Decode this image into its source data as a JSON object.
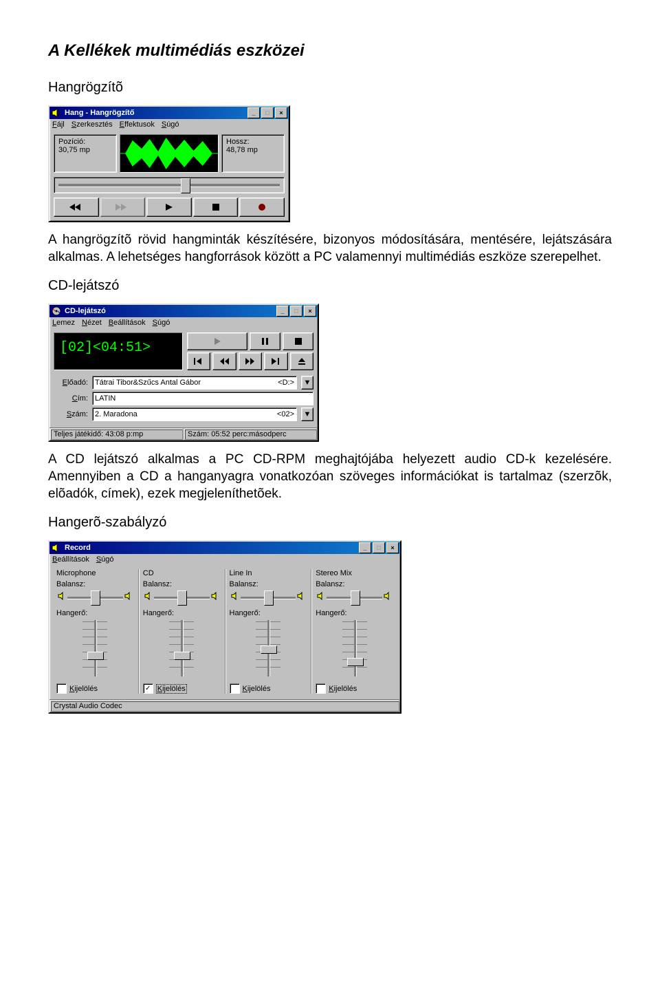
{
  "page": {
    "title": "A Kellékek multimédiás eszközei",
    "sections": {
      "recorder_head": "Hangrögzítõ",
      "recorder_text": "A hangrögzítõ rövid hangminták készítésére, bizonyos módosítására, mentésére, lejátszására alkalmas. A lehetséges hangforrások között a PC valamennyi multimédiás eszköze szerepelhet.",
      "cd_head": "CD-lejátszó",
      "cd_text": "A CD lejátszó alkalmas a PC CD-RPM meghajtójába helyezett audio CD-k kezelésére. Amennyiben a CD a hanganyagra vonatkozóan szöveges információkat is tartalmaz (szerzõk, elõadók, címek), ezek megjeleníthetõek.",
      "mixer_head": "Hangerõ-szabályzó"
    }
  },
  "recorder": {
    "title": "Hang - Hangrögzítő",
    "menus": [
      "Fájl",
      "Szerkesztés",
      "Effektusok",
      "Súgó"
    ],
    "position_label": "Pozíció:",
    "position_value": "30,75 mp",
    "length_label": "Hossz:",
    "length_value": "48,78 mp"
  },
  "cd": {
    "title": "CD-lejátszó",
    "menus": [
      "Lemez",
      "Nézet",
      "Beállítások",
      "Súgó"
    ],
    "display": "[02]<04:51>",
    "artist_label": "Előadó:",
    "artist_value": "Tátrai Tibor&Szűcs Antal Gábor",
    "artist_drive": "<D:>",
    "title_label": "Cím:",
    "title_value": "LATIN",
    "track_label": "Szám:",
    "track_value": "2. Maradona",
    "track_num": "<02>",
    "status1": "Teljes játékidő: 43:08 p:mp",
    "status2": "Szám: 05:52 perc:másodperc"
  },
  "mixer": {
    "title": "Record",
    "menus": [
      "Beállítások",
      "Súgó"
    ],
    "balance_label": "Balansz:",
    "volume_label": "Hangerő:",
    "select_label": "Kijelölés",
    "status": "Crystal Audio Codec",
    "channels": [
      {
        "name": "Microphone",
        "selected": false,
        "vol": 0.38
      },
      {
        "name": "CD",
        "selected": true,
        "vol": 0.38
      },
      {
        "name": "Line In",
        "selected": false,
        "vol": 0.5
      },
      {
        "name": "Stereo Mix",
        "selected": false,
        "vol": 0.25
      }
    ]
  }
}
